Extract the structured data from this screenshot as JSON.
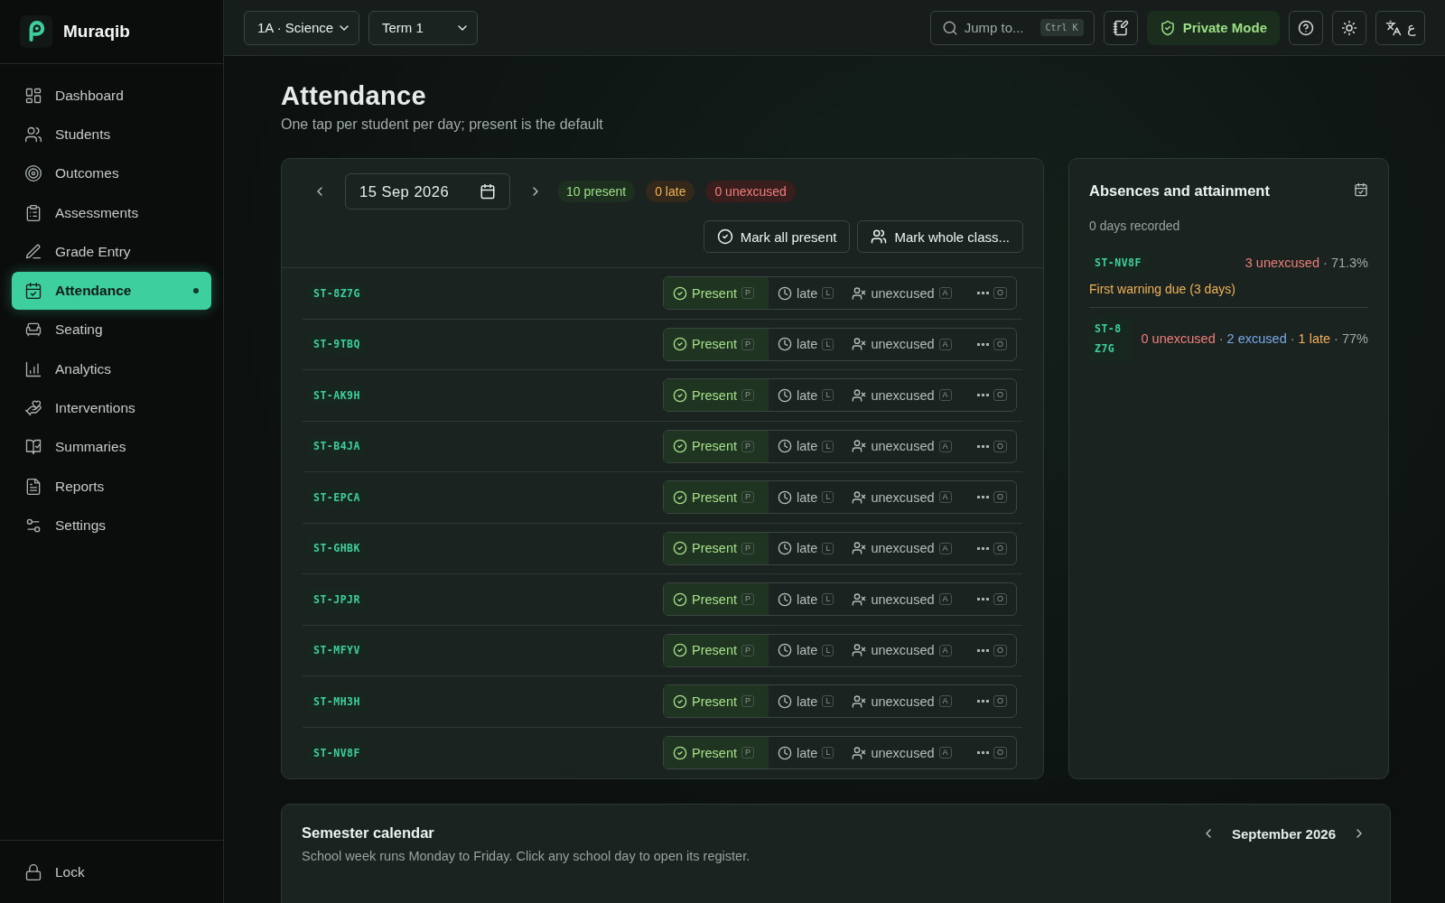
{
  "brand": {
    "name": "Muraqib"
  },
  "nav": [
    {
      "label": "Dashboard",
      "selected": false
    },
    {
      "label": "Students",
      "selected": false
    },
    {
      "label": "Outcomes",
      "selected": false
    },
    {
      "label": "Assessments",
      "selected": false
    },
    {
      "label": "Grade Entry",
      "selected": false
    },
    {
      "label": "Attendance",
      "selected": true
    },
    {
      "label": "Seating",
      "selected": false
    },
    {
      "label": "Analytics",
      "selected": false
    },
    {
      "label": "Interventions",
      "selected": false
    },
    {
      "label": "Summaries",
      "selected": false
    },
    {
      "label": "Reports",
      "selected": false
    },
    {
      "label": "Settings",
      "selected": false
    }
  ],
  "lock": {
    "label": "Lock"
  },
  "topbar": {
    "class_select": "1A · Science",
    "term_select": "Term 1",
    "search": {
      "placeholder": "Jump to...",
      "shortcut": "Ctrl K"
    },
    "private_mode": "Private Mode",
    "language": "ع"
  },
  "page": {
    "title": "Attendance",
    "subtitle": "One tap per student per day; present is the default"
  },
  "register": {
    "date": "15 Sep 2026",
    "counts": [
      {
        "text": "10 present",
        "kind": "present"
      },
      {
        "text": "0 late",
        "kind": "late"
      },
      {
        "text": "0 unexcused",
        "kind": "unexcused"
      }
    ],
    "actions": [
      "Mark all present",
      "Mark whole class..."
    ],
    "rows": [
      {
        "id": "ST-8Z7G",
        "marks": [
          {
            "kind": "present",
            "label": "Present",
            "key": "P",
            "selected": true
          },
          {
            "kind": "late",
            "label": "late",
            "key": "L",
            "selected": false
          },
          {
            "kind": "unexcused",
            "label": "unexcused",
            "key": "A",
            "selected": false
          },
          {
            "kind": "other",
            "key": "O",
            "selected": false
          }
        ]
      },
      {
        "id": "ST-9TBQ",
        "marks": [
          {
            "kind": "present",
            "label": "Present",
            "key": "P",
            "selected": true
          },
          {
            "kind": "late",
            "label": "late",
            "key": "L",
            "selected": false
          },
          {
            "kind": "unexcused",
            "label": "unexcused",
            "key": "A",
            "selected": false
          },
          {
            "kind": "other",
            "key": "O",
            "selected": false
          }
        ]
      },
      {
        "id": "ST-AK9H",
        "marks": [
          {
            "kind": "present",
            "label": "Present",
            "key": "P",
            "selected": true
          },
          {
            "kind": "late",
            "label": "late",
            "key": "L",
            "selected": false
          },
          {
            "kind": "unexcused",
            "label": "unexcused",
            "key": "A",
            "selected": false
          },
          {
            "kind": "other",
            "key": "O",
            "selected": false
          }
        ]
      },
      {
        "id": "ST-B4JA",
        "marks": [
          {
            "kind": "present",
            "label": "Present",
            "key": "P",
            "selected": true
          },
          {
            "kind": "late",
            "label": "late",
            "key": "L",
            "selected": false
          },
          {
            "kind": "unexcused",
            "label": "unexcused",
            "key": "A",
            "selected": false
          },
          {
            "kind": "other",
            "key": "O",
            "selected": false
          }
        ]
      },
      {
        "id": "ST-EPCA",
        "marks": [
          {
            "kind": "present",
            "label": "Present",
            "key": "P",
            "selected": true
          },
          {
            "kind": "late",
            "label": "late",
            "key": "L",
            "selected": false
          },
          {
            "kind": "unexcused",
            "label": "unexcused",
            "key": "A",
            "selected": false
          },
          {
            "kind": "other",
            "key": "O",
            "selected": false
          }
        ]
      },
      {
        "id": "ST-GHBK",
        "marks": [
          {
            "kind": "present",
            "label": "Present",
            "key": "P",
            "selected": true
          },
          {
            "kind": "late",
            "label": "late",
            "key": "L",
            "selected": false
          },
          {
            "kind": "unexcused",
            "label": "unexcused",
            "key": "A",
            "selected": false
          },
          {
            "kind": "other",
            "key": "O",
            "selected": false
          }
        ]
      },
      {
        "id": "ST-JPJR",
        "marks": [
          {
            "kind": "present",
            "label": "Present",
            "key": "P",
            "selected": true
          },
          {
            "kind": "late",
            "label": "late",
            "key": "L",
            "selected": false
          },
          {
            "kind": "unexcused",
            "label": "unexcused",
            "key": "A",
            "selected": false
          },
          {
            "kind": "other",
            "key": "O",
            "selected": false
          }
        ]
      },
      {
        "id": "ST-MFYV",
        "marks": [
          {
            "kind": "present",
            "label": "Present",
            "key": "P",
            "selected": true
          },
          {
            "kind": "late",
            "label": "late",
            "key": "L",
            "selected": false
          },
          {
            "kind": "unexcused",
            "label": "unexcused",
            "key": "A",
            "selected": false
          },
          {
            "kind": "other",
            "key": "O",
            "selected": false
          }
        ]
      },
      {
        "id": "ST-MH3H",
        "marks": [
          {
            "kind": "present",
            "label": "Present",
            "key": "P",
            "selected": true
          },
          {
            "kind": "late",
            "label": "late",
            "key": "L",
            "selected": false
          },
          {
            "kind": "unexcused",
            "label": "unexcused",
            "key": "A",
            "selected": false
          },
          {
            "kind": "other",
            "key": "O",
            "selected": false
          }
        ]
      },
      {
        "id": "ST-NV8F",
        "marks": [
          {
            "kind": "present",
            "label": "Present",
            "key": "P",
            "selected": true
          },
          {
            "kind": "late",
            "label": "late",
            "key": "L",
            "selected": false
          },
          {
            "kind": "unexcused",
            "label": "unexcused",
            "key": "A",
            "selected": false
          },
          {
            "kind": "other",
            "key": "O",
            "selected": false
          }
        ]
      }
    ]
  },
  "absences": {
    "title": "Absences and attainment",
    "recorded": "0 days recorded",
    "students": [
      {
        "id": "ST-NV8F",
        "stats": [
          {
            "text": "3 unexcused",
            "kind": "unexcused"
          },
          {
            "text": " · 71.3%",
            "kind": "muted"
          }
        ],
        "warning": "First warning due (3 days)"
      },
      {
        "id": "ST-8Z7G",
        "stats": [
          {
            "text": "0 unexcused",
            "kind": "unexcused"
          },
          {
            "text": " · ",
            "kind": "muted"
          },
          {
            "text": "2 excused",
            "kind": "excused"
          },
          {
            "text": " · ",
            "kind": "muted"
          },
          {
            "text": "1 late",
            "kind": "late"
          },
          {
            "text": " · 77%",
            "kind": "muted"
          }
        ]
      }
    ]
  },
  "calendar": {
    "title": "Semester calendar",
    "subtitle": "School week runs Monday to Friday. Click any school day to open its register.",
    "month": "September 2026"
  }
}
